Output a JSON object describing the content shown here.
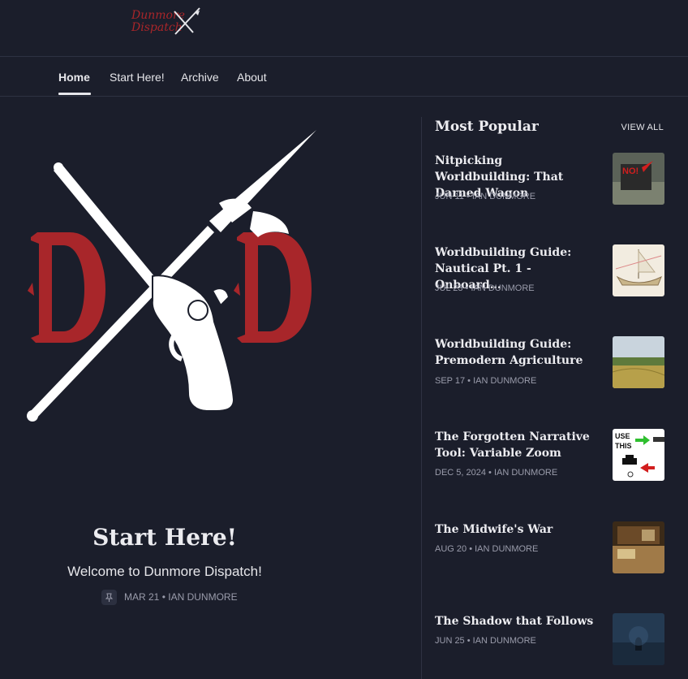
{
  "logo": {
    "line1": "Dunmore",
    "line2": "Dispatch"
  },
  "nav": {
    "items": [
      "Home",
      "Start Here!",
      "Archive",
      "About"
    ],
    "active": "Home"
  },
  "hero": {
    "title": "Start Here!",
    "subtitle": "Welcome to Dunmore Dispatch!",
    "date": "MAR 21",
    "author": "IAN DUNMORE",
    "pin_icon": "pin-icon"
  },
  "sidebar": {
    "heading": "Most Popular",
    "view_all": "VIEW ALL",
    "posts": [
      {
        "title": "Nitpicking Worldbuilding: That Darned Wagon",
        "date": "JUN 11",
        "author": "IAN DUNMORE"
      },
      {
        "title": "Worldbuilding Guide: Nautical Pt. 1 - Onboard…",
        "date": "JUL 23",
        "author": "IAN DUNMORE"
      },
      {
        "title": "Worldbuilding Guide: Premodern Agriculture",
        "date": "SEP 17",
        "author": "IAN DUNMORE"
      },
      {
        "title": "The Forgotten Narrative Tool: Variable Zoom",
        "date": "DEC 5, 2024",
        "author": "IAN DUNMORE"
      },
      {
        "title": "The Midwife's War",
        "date": "AUG 20",
        "author": "IAN DUNMORE"
      },
      {
        "title": "The Shadow that Follows",
        "date": "JUN 25",
        "author": "IAN DUNMORE"
      }
    ],
    "thumb_text": {
      "wagon": "NO!",
      "zoom_use": "USE",
      "zoom_this": "THIS"
    }
  },
  "colors": {
    "background": "#1b1e2b",
    "brand_red": "#a8262a",
    "divider": "#2e3242",
    "muted": "#9a9cab"
  }
}
